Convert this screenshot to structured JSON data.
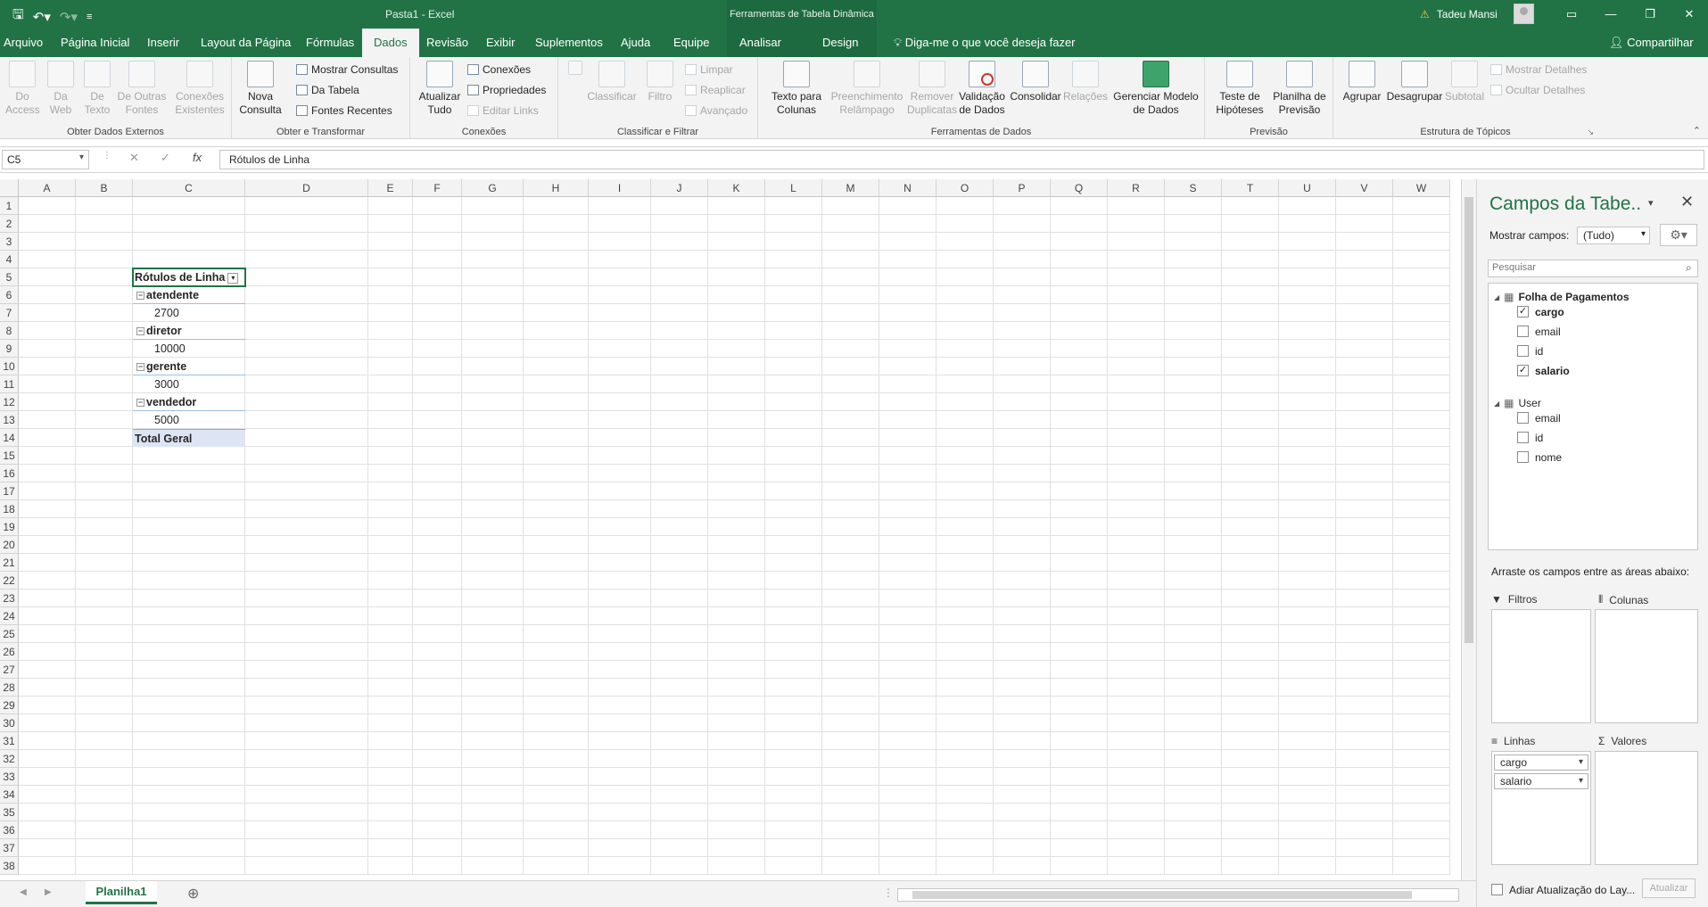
{
  "app": {
    "document_title": "Pasta1  -  Excel",
    "context_tab_group": "Ferramentas de Tabela Dinâmica",
    "user_name": "Tadeu Mansi"
  },
  "tabs": [
    "Arquivo",
    "Página Inicial",
    "Inserir",
    "Layout da Página",
    "Fórmulas",
    "Dados",
    "Revisão",
    "Exibir",
    "Suplementos",
    "Ajuda",
    "Equipe",
    "Analisar",
    "Design"
  ],
  "active_tab": "Dados",
  "tell_me": "Diga-me o que você deseja fazer",
  "share": "Compartilhar",
  "ribbon": {
    "obter_externos": {
      "label": "Obter Dados Externos",
      "do_access": "Do Access",
      "da_web": "Da Web",
      "de_texto": "De Texto",
      "de_outras": "De Outras Fontes",
      "existentes": "Conexões Existentes"
    },
    "obter_transformar": {
      "label": "Obter e Transformar",
      "nova_consulta": "Nova Consulta",
      "mostrar_consultas": "Mostrar Consultas",
      "da_tabela": "Da Tabela",
      "fontes_recentes": "Fontes Recentes"
    },
    "conexoes": {
      "label": "Conexões",
      "atualizar_tudo": "Atualizar Tudo",
      "conexoes": "Conexões",
      "propriedades": "Propriedades",
      "editar_links": "Editar Links"
    },
    "classificar": {
      "label": "Classificar e Filtrar",
      "classificar": "Classificar",
      "filtro": "Filtro",
      "limpar": "Limpar",
      "reaplicar": "Reaplicar",
      "avancado": "Avançado"
    },
    "ferramentas": {
      "label": "Ferramentas de Dados",
      "texto_colunas": "Texto para Colunas",
      "preenchimento": "Preenchimento Relâmpago",
      "remover": "Remover Duplicatas",
      "validacao": "Validação de Dados",
      "consolidar": "Consolidar",
      "relacoes": "Relações",
      "gerenciar": "Gerenciar Modelo de Dados"
    },
    "previsao": {
      "label": "Previsão",
      "teste": "Teste de Hipóteses",
      "planilha": "Planilha de Previsão"
    },
    "topicos": {
      "label": "Estrutura de Tópicos",
      "agrupar": "Agrupar",
      "desagrupar": "Desagrupar",
      "subtotal": "Subtotal",
      "mostrar_detalhes": "Mostrar Detalhes",
      "ocultar_detalhes": "Ocultar Detalhes"
    }
  },
  "formula_bar": {
    "name_box": "C5",
    "formula": "Rótulos de Linha"
  },
  "columns": [
    "A",
    "B",
    "C",
    "D",
    "E",
    "F",
    "G",
    "H",
    "I",
    "J",
    "K",
    "L",
    "M",
    "N",
    "O",
    "P",
    "Q",
    "R",
    "S",
    "T",
    "U",
    "V",
    "W"
  ],
  "rows": [
    "1",
    "2",
    "3",
    "4",
    "5",
    "6",
    "7",
    "8",
    "9",
    "10",
    "11",
    "12",
    "13",
    "14",
    "15",
    "16",
    "17",
    "18",
    "19",
    "20",
    "21",
    "22",
    "23",
    "24",
    "25",
    "26",
    "27",
    "28",
    "29",
    "30",
    "31",
    "32",
    "33",
    "34",
    "35",
    "36",
    "37",
    "38"
  ],
  "pivot": {
    "header": "Rótulos de Linha",
    "items": [
      {
        "label": "atendente",
        "value": "2700"
      },
      {
        "label": "diretor",
        "value": "10000"
      },
      {
        "label": "gerente",
        "value": "3000"
      },
      {
        "label": "vendedor",
        "value": "5000"
      }
    ],
    "total": "Total Geral"
  },
  "sheet_tab": "Planilha1",
  "pane": {
    "title": "Campos da Tabe..",
    "show_fields_label": "Mostrar campos:",
    "show_fields_value": "(Tudo)",
    "search_placeholder": "Pesquisar",
    "tables": [
      {
        "name": "Folha de Pagamentos",
        "fields": [
          {
            "name": "cargo",
            "checked": true
          },
          {
            "name": "email",
            "checked": false
          },
          {
            "name": "id",
            "checked": false
          },
          {
            "name": "salario",
            "checked": true
          }
        ]
      },
      {
        "name": "User",
        "fields": [
          {
            "name": "email",
            "checked": false
          },
          {
            "name": "id",
            "checked": false
          },
          {
            "name": "nome",
            "checked": false
          }
        ]
      }
    ],
    "drag_hint": "Arraste os campos entre as áreas abaixo:",
    "filters": "Filtros",
    "columns": "Colunas",
    "rows": "Linhas",
    "values": "Valores",
    "row_fields": [
      "cargo",
      "salario"
    ],
    "defer_update": "Adiar Atualização do Lay...",
    "update_button": "Atualizar"
  }
}
